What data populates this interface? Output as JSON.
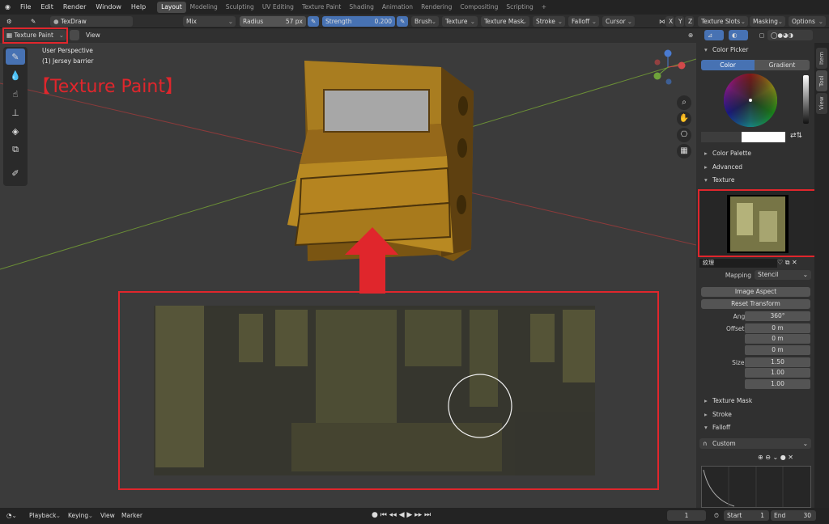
{
  "menu": [
    "File",
    "Edit",
    "Render",
    "Window",
    "Help"
  ],
  "workspaces": [
    "Layout",
    "Modeling",
    "Sculpting",
    "UV Editing",
    "Texture Paint",
    "Shading",
    "Animation",
    "Rendering",
    "Compositing",
    "Scripting"
  ],
  "active_workspace": "Layout",
  "tool_header": {
    "brush_name": "TexDraw",
    "blend": "Mix",
    "radius_label": "Radius",
    "radius_value": "57 px",
    "strength_label": "Strength",
    "strength_value": "0.200",
    "menus": [
      "Brush",
      "Texture",
      "Texture Mask",
      "Stroke",
      "Falloff",
      "Cursor"
    ],
    "axes": [
      "X",
      "Y",
      "Z"
    ],
    "texture_slots": "Texture Slots",
    "masking": "Masking",
    "options": "Options"
  },
  "viewport_header": {
    "mode": "Texture Paint",
    "view": "View"
  },
  "viewport": {
    "perspective": "User Perspective",
    "object": "(1) Jersey barrier",
    "annotation": "【Texture Paint】"
  },
  "sidebar": {
    "color_picker": "Color Picker",
    "color_tab": "Color",
    "gradient_tab": "Gradient",
    "color_palette": "Color Palette",
    "advanced": "Advanced",
    "texture": "Texture",
    "texture_name": "紋理",
    "mapping_label": "Mapping",
    "mapping_value": "Stencil",
    "image_aspect": "Image Aspect",
    "reset_transform": "Reset Transform",
    "angle_label": "Angle",
    "angle_value": "360°",
    "offset": {
      "x_label": "Offset X",
      "x": "0 m",
      "y_label": "Y",
      "y": "0 m",
      "z_label": "Z",
      "z": "0 m"
    },
    "size": {
      "x_label": "Size X",
      "x": "1.50",
      "y_label": "Y",
      "y": "1.00",
      "z_label": "Z",
      "z": "1.00"
    },
    "texture_mask": "Texture Mask",
    "stroke": "Stroke",
    "falloff": "Falloff",
    "falloff_curve": "Custom"
  },
  "side_tabs": [
    "Item",
    "Tool",
    "View"
  ],
  "timeline": {
    "playback": "Playback",
    "keying": "Keying",
    "view": "View",
    "marker": "Marker",
    "current_frame": "1",
    "start_label": "Start",
    "start": "1",
    "end_label": "End",
    "end": "30"
  },
  "colors": {
    "accent": "#4772b3",
    "annotation": "#e0262c"
  }
}
